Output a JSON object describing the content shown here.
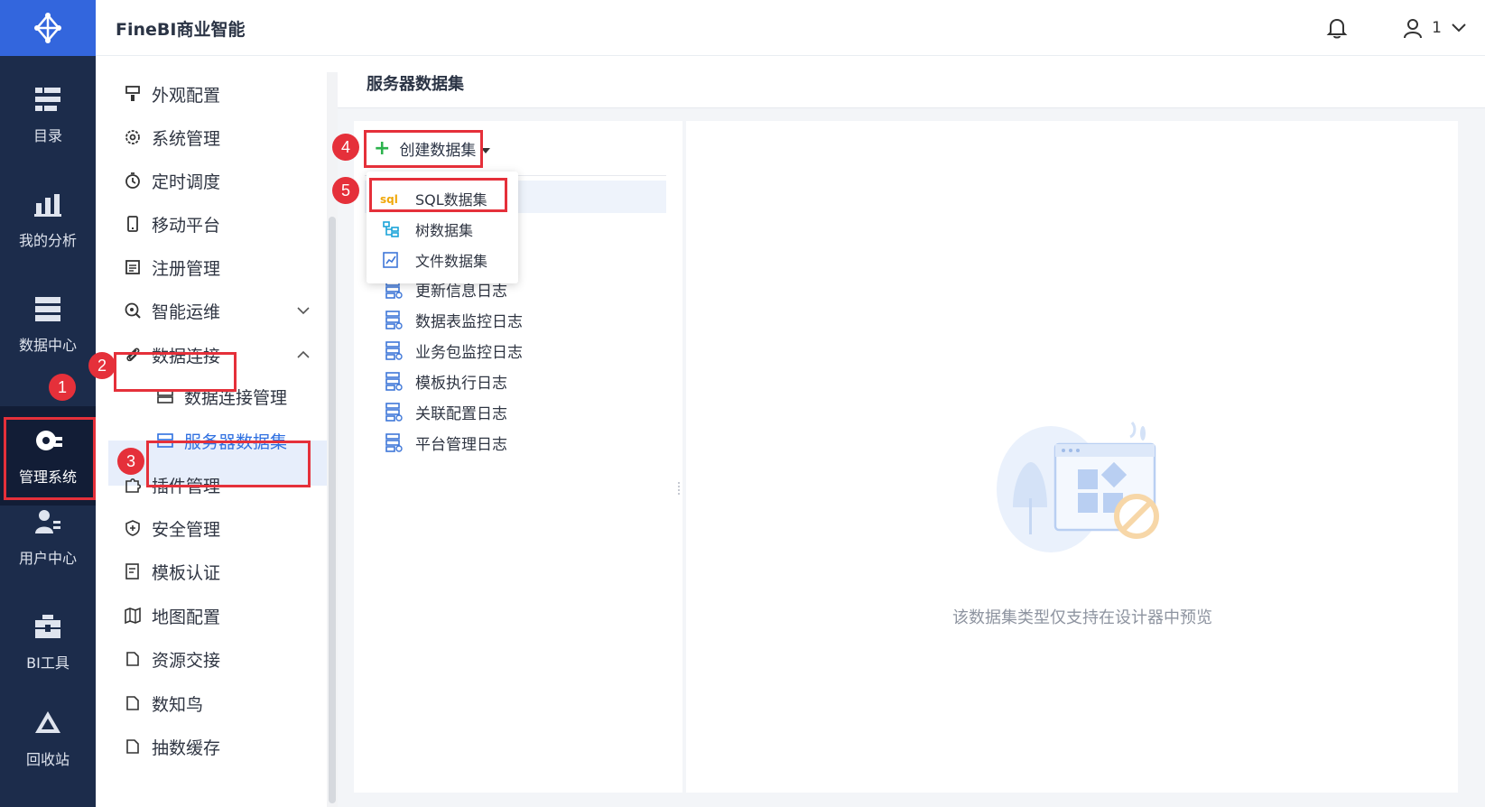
{
  "app": {
    "title": "FineBI商业智能"
  },
  "header": {
    "user_name": "1"
  },
  "rail": {
    "items": [
      {
        "label": "目录",
        "icon": "catalog-icon"
      },
      {
        "label": "我的分析",
        "icon": "analysis-icon"
      },
      {
        "label": "数据中心",
        "icon": "data-center-icon"
      },
      {
        "label": "管理系统",
        "icon": "gear-icon"
      },
      {
        "label": "用户中心",
        "icon": "user-center-icon"
      },
      {
        "label": "BI工具",
        "icon": "toolbox-icon"
      },
      {
        "label": "回收站",
        "icon": "recycle-icon"
      }
    ]
  },
  "menu": {
    "items": [
      {
        "label": "外观配置"
      },
      {
        "label": "系统管理"
      },
      {
        "label": "定时调度"
      },
      {
        "label": "移动平台"
      },
      {
        "label": "注册管理"
      },
      {
        "label": "智能运维"
      },
      {
        "label": "数据连接"
      },
      {
        "label": "数据连接管理"
      },
      {
        "label": "服务器数据集"
      },
      {
        "label": "插件管理"
      },
      {
        "label": "安全管理"
      },
      {
        "label": "模板认证"
      },
      {
        "label": "地图配置"
      },
      {
        "label": "资源交接"
      },
      {
        "label": "数知鸟"
      },
      {
        "label": "抽数缓存"
      }
    ]
  },
  "content": {
    "breadcrumb": "服务器数据集",
    "create_label": "创建数据集",
    "dropdown": [
      {
        "label": "SQL数据集",
        "icon": "sql-icon"
      },
      {
        "label": "树数据集",
        "icon": "tree-icon"
      },
      {
        "label": "文件数据集",
        "icon": "file-icon"
      }
    ],
    "datasets": [
      {
        "label": "更新信息日志"
      },
      {
        "label": "数据表监控日志"
      },
      {
        "label": "业务包监控日志"
      },
      {
        "label": "模板执行日志"
      },
      {
        "label": "关联配置日志"
      },
      {
        "label": "平台管理日志"
      }
    ],
    "empty_text": "该数据集类型仅支持在设计器中预览"
  },
  "annotations": {
    "steps": [
      "1",
      "2",
      "3",
      "4",
      "5"
    ],
    "color": "#e5303a"
  },
  "colors": {
    "rail_bg": "#1c2c4b",
    "logo_bg": "#3366dd",
    "accent": "#2f6fe0"
  }
}
